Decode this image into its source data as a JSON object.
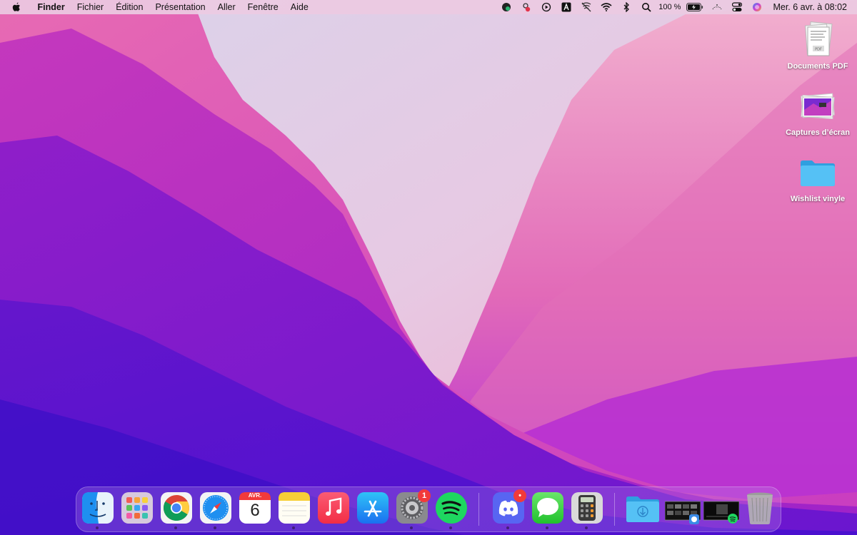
{
  "menubar": {
    "app_name": "Finder",
    "items": [
      "Fichier",
      "Édition",
      "Présentation",
      "Aller",
      "Fenêtre",
      "Aide"
    ],
    "battery_percent": "100 %",
    "clock": "Mer. 6 avr. à  08:02",
    "status_icons": [
      "grammarly-icon",
      "screen-recorder-icon",
      "play-icon",
      "font-icon",
      "mute-icon",
      "wifi-icon",
      "bluetooth-icon",
      "spotlight-search-icon",
      "battery-icon",
      "weather-icon",
      "control-center-icon",
      "siri-icon"
    ]
  },
  "desktop": {
    "items": [
      {
        "label": "Documents PDF",
        "icon": "pdf-stack-icon"
      },
      {
        "label": "Captures d’écran",
        "icon": "screenshots-stack-icon"
      },
      {
        "label": "Wishlist vinyle",
        "icon": "folder-icon"
      }
    ]
  },
  "dock": {
    "apps": [
      "Finder",
      "Launchpad",
      "Google Chrome",
      "Safari",
      "Calendrier",
      "Notes",
      "Musique",
      "App Store",
      "Préférences Système",
      "Spotify",
      "Discord",
      "Messages",
      "Calculette",
      "Téléchargements",
      "Pile de captures",
      "Pile Spotify",
      "Corbeille"
    ],
    "calendar_month": "AVR.",
    "calendar_day": "6",
    "system_prefs_badge": "1",
    "discord_badge": "•"
  },
  "colors": {
    "menubar": "#ecd0e4",
    "accent_badge": "#f23a3a",
    "folder_blue": "#3fb6f0",
    "spotify_green": "#1ed760"
  }
}
